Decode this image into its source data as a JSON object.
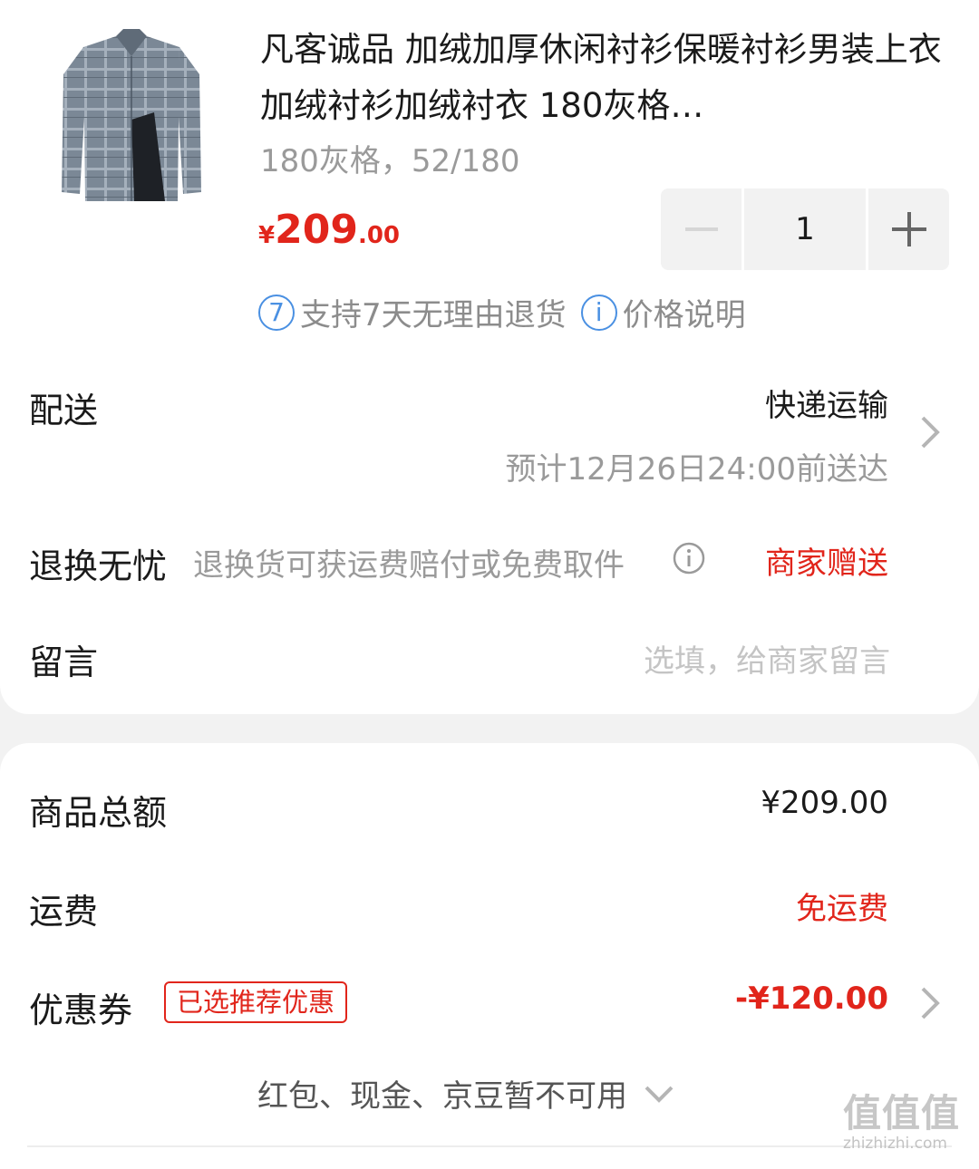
{
  "product": {
    "title": "凡客诚品 加绒加厚休闲衬衫保暖衬衫男装上衣加绒衬衫加绒衬衣 180灰格…",
    "spec": "180灰格，52/180",
    "price_currency": "¥",
    "price_int": "209",
    "price_dec": ".00",
    "quantity": "1",
    "tags": [
      {
        "icon": "7",
        "label": "支持7天无理由退货",
        "icon_name": "seven-days-icon"
      },
      {
        "icon": "i",
        "label": "价格说明",
        "icon_name": "info-icon"
      }
    ]
  },
  "delivery": {
    "label": "配送",
    "method": "快递运输",
    "estimate": "预计12月26日24:00前送达"
  },
  "returns": {
    "label": "退换无忧",
    "desc": "退换货可获运费赔付或免费取件",
    "value": "商家赠送"
  },
  "message": {
    "label": "留言",
    "placeholder": "选填，给商家留言"
  },
  "summary": {
    "goods_total_label": "商品总额",
    "goods_total_value": "¥209.00",
    "shipping_label": "运费",
    "shipping_value": "免运费",
    "coupon_label": "优惠券",
    "coupon_badge": "已选推荐优惠",
    "coupon_value": "-¥120.00",
    "unavailable_text": "红包、现金、京豆暂不可用"
  },
  "watermark": {
    "logo": "值值值",
    "site": "zhizhizhi.com"
  },
  "colors": {
    "accent_red": "#e1251b",
    "info_blue": "#4a90e2",
    "muted_gray": "#9a9a9a"
  }
}
